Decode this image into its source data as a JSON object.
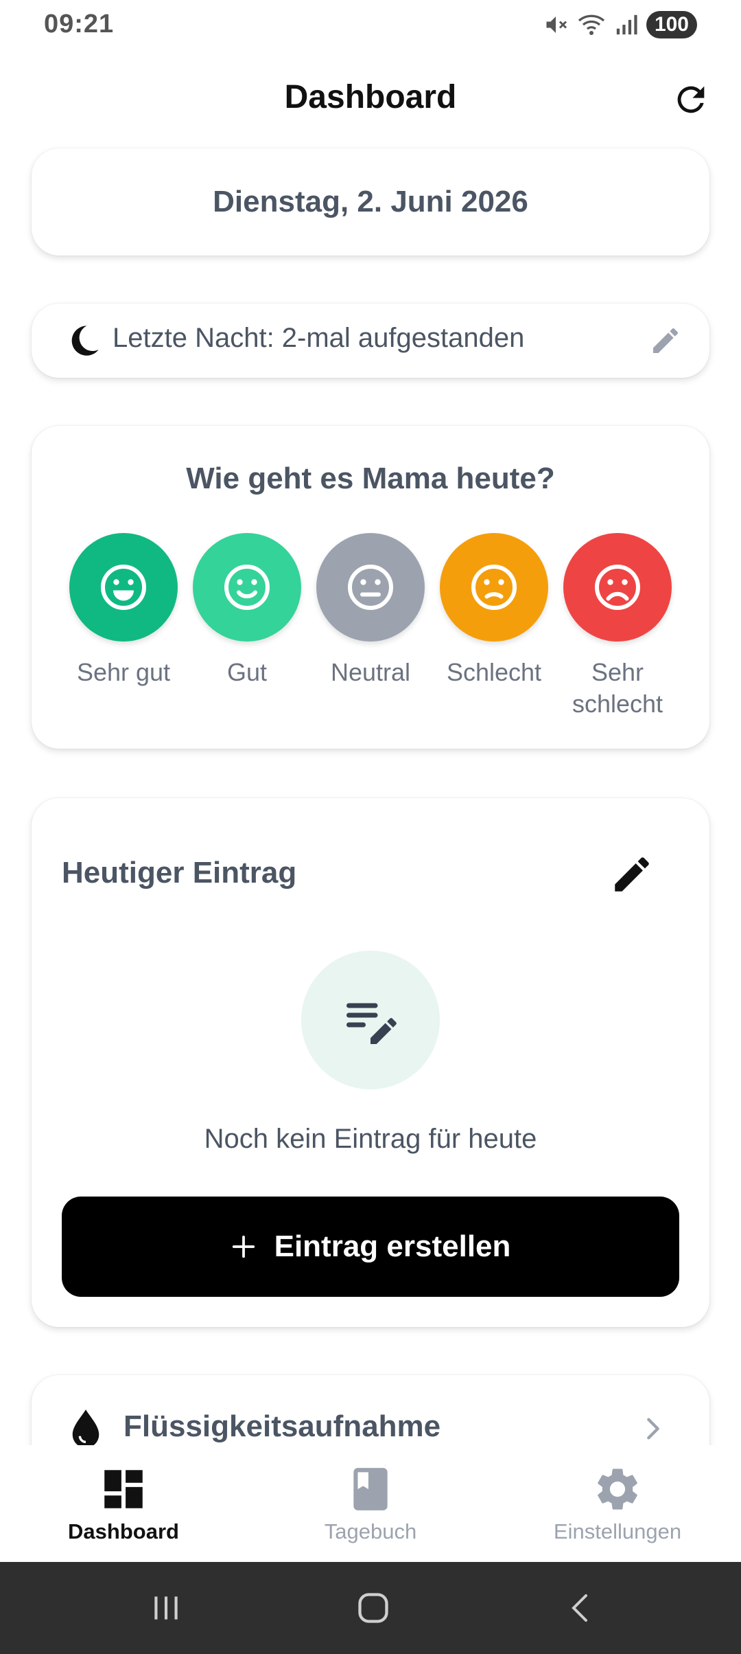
{
  "status_bar": {
    "time": "09:21",
    "battery": "100",
    "icons": [
      "mute-icon",
      "wifi-icon",
      "signal-icon"
    ]
  },
  "app_bar": {
    "title": "Dashboard",
    "refresh_icon": "refresh-icon"
  },
  "date_card": {
    "text": "Dienstag, 2. Juni 2026"
  },
  "night_card": {
    "icon": "moon-icon",
    "text": "Letzte Nacht: 2-mal aufgestanden",
    "edit_icon": "pencil-icon"
  },
  "mood_card": {
    "title": "Wie geht es Mama heute?",
    "options": [
      {
        "label": "Sehr gut",
        "color": "#10b981",
        "face": "very-happy-face-icon"
      },
      {
        "label": "Gut",
        "color": "#34d399",
        "face": "happy-face-icon"
      },
      {
        "label": "Neutral",
        "color": "#9ca3af",
        "face": "neutral-face-icon"
      },
      {
        "label": "Schlecht",
        "color": "#f59e0b",
        "face": "sad-face-icon"
      },
      {
        "label": "Sehr schlecht",
        "color": "#ef4444",
        "face": "very-sad-face-icon"
      }
    ]
  },
  "entry_card": {
    "title": "Heutiger Eintrag",
    "edit_icon": "pencil-icon",
    "empty_icon": "note-edit-icon",
    "empty_text": "Noch kein Eintrag für heute",
    "create_button": "Eintrag erstellen"
  },
  "fluid_card": {
    "icon": "water-drop-icon",
    "title": "Flüssigkeitsaufnahme"
  },
  "bottom_nav": {
    "items": [
      {
        "label": "Dashboard",
        "icon": "dashboard-icon",
        "active": true
      },
      {
        "label": "Tagebuch",
        "icon": "book-icon",
        "active": false
      },
      {
        "label": "Einstellungen",
        "icon": "gear-icon",
        "active": false
      }
    ]
  },
  "colors": {
    "accent_green": "#10b981",
    "text_primary": "#4b5563",
    "button_bg": "#000000"
  }
}
